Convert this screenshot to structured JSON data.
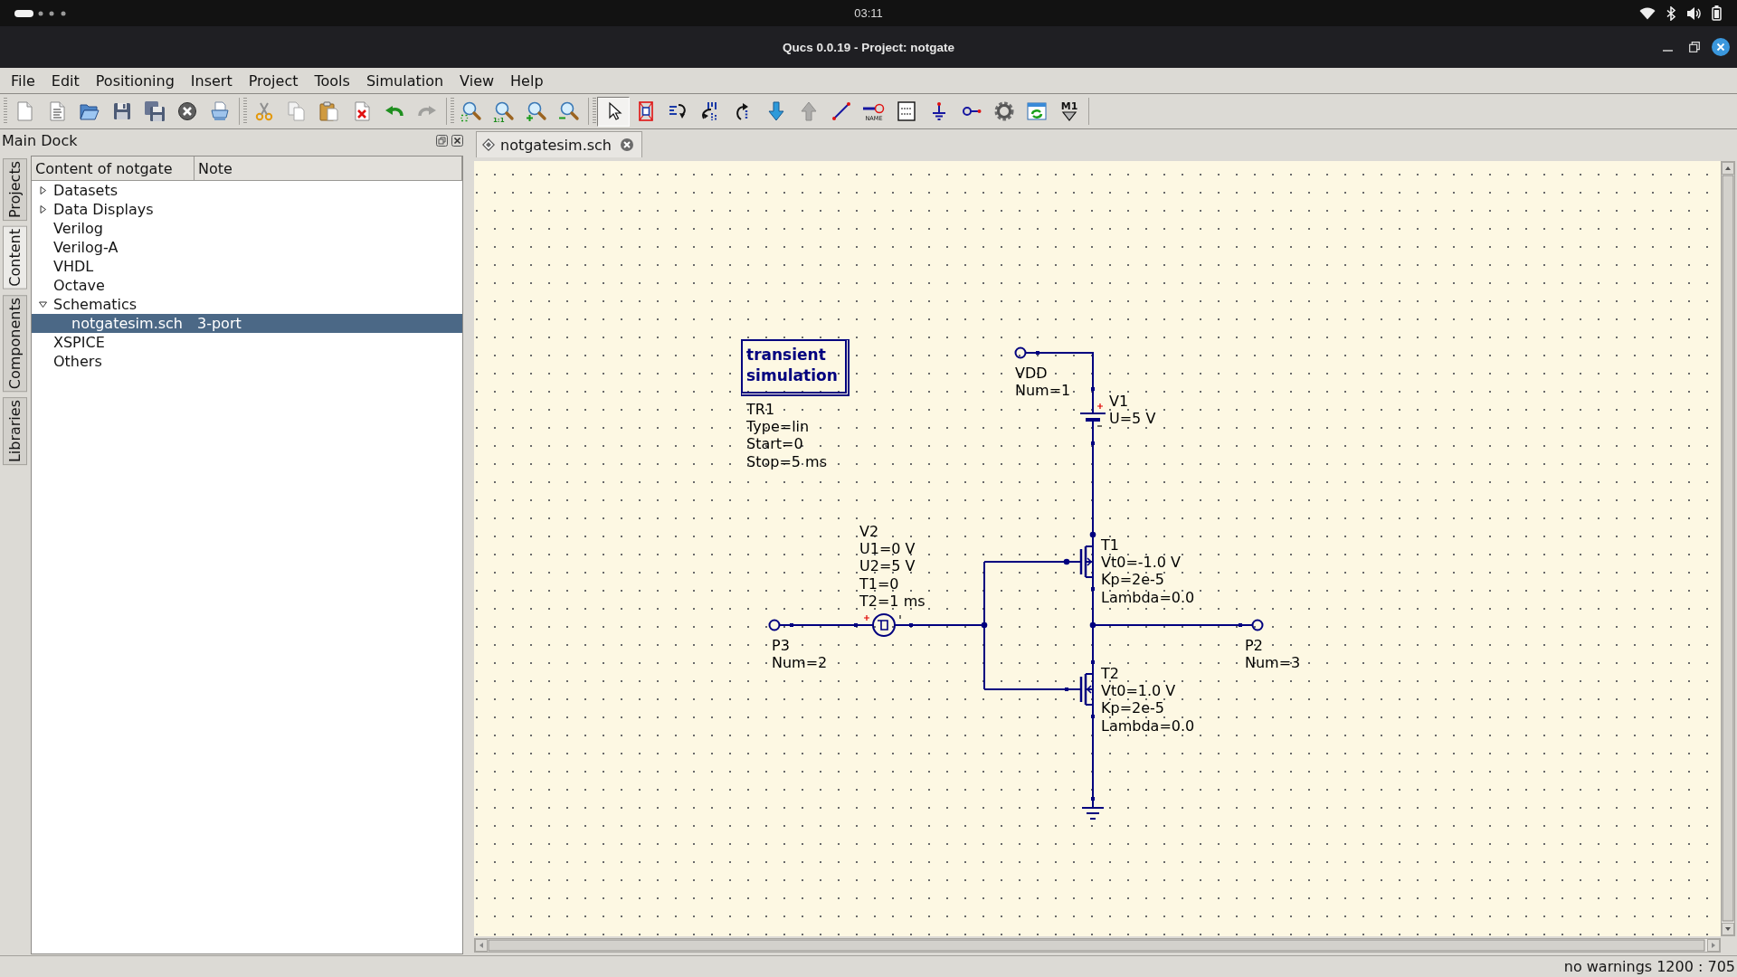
{
  "system_bar": {
    "clock": "03:11"
  },
  "window": {
    "title": "Qucs 0.0.19 - Project: notgate"
  },
  "menu_bar": [
    "File",
    "Edit",
    "Positioning",
    "Insert",
    "Project",
    "Tools",
    "Simulation",
    "View",
    "Help"
  ],
  "toolbar": {
    "groups": [
      {
        "tools": [
          {
            "kind": "page",
            "selected": false,
            "disabled": false
          },
          {
            "kind": "textpage",
            "selected": false,
            "disabled": false
          },
          {
            "kind": "folder",
            "selected": false,
            "disabled": false
          },
          {
            "kind": "floppy",
            "selected": false,
            "disabled": false
          },
          {
            "kind": "floppies",
            "selected": false,
            "disabled": false
          },
          {
            "kind": "closefile",
            "selected": false,
            "disabled": false
          },
          {
            "kind": "printer",
            "selected": false,
            "disabled": false
          }
        ]
      },
      {
        "tools": [
          {
            "kind": "scissors",
            "selected": false,
            "disabled": false
          },
          {
            "kind": "copy",
            "selected": false,
            "disabled": false
          },
          {
            "kind": "paste",
            "selected": false,
            "disabled": false
          },
          {
            "kind": "delete",
            "selected": false,
            "disabled": false
          },
          {
            "kind": "undo",
            "selected": false,
            "disabled": false
          },
          {
            "kind": "redo",
            "selected": false,
            "disabled": true
          }
        ]
      },
      {
        "tools": [
          {
            "kind": "zoomfit",
            "selected": false,
            "disabled": false
          },
          {
            "kind": "zoomone",
            "label": "1:1",
            "selected": false,
            "disabled": false
          },
          {
            "kind": "zoomin",
            "selected": false,
            "disabled": false
          },
          {
            "kind": "zoomout",
            "selected": false,
            "disabled": false
          }
        ]
      },
      {
        "tools": [
          {
            "kind": "pointer",
            "selected": true,
            "disabled": false
          },
          {
            "kind": "deactivate",
            "selected": false,
            "disabled": false
          },
          {
            "kind": "mirrorx",
            "selected": false,
            "disabled": false
          },
          {
            "kind": "mirrory",
            "selected": false,
            "disabled": false
          },
          {
            "kind": "rotate",
            "selected": false,
            "disabled": false
          },
          {
            "kind": "down",
            "selected": false,
            "disabled": false
          },
          {
            "kind": "up",
            "selected": false,
            "disabled": true
          },
          {
            "kind": "wire",
            "selected": false,
            "disabled": false
          },
          {
            "kind": "label",
            "label": "NAME",
            "selected": false,
            "disabled": false
          },
          {
            "kind": "equation",
            "selected": false,
            "disabled": false
          },
          {
            "kind": "ground",
            "selected": false,
            "disabled": false
          },
          {
            "kind": "port",
            "selected": false,
            "disabled": false
          },
          {
            "kind": "simulate",
            "selected": false,
            "disabled": false
          },
          {
            "kind": "display",
            "selected": false,
            "disabled": false
          },
          {
            "kind": "marker",
            "label": "M1",
            "selected": false,
            "disabled": false
          }
        ]
      }
    ]
  },
  "dock": {
    "title": "Main Dock",
    "side_tabs": [
      {
        "label": "Projects",
        "selected": false
      },
      {
        "label": "Content",
        "selected": true
      },
      {
        "label": "Components",
        "selected": false
      },
      {
        "label": "Libraries",
        "selected": false
      }
    ],
    "tree": {
      "columns": [
        "Content of notgate",
        "Note"
      ],
      "items": [
        {
          "label": "Datasets",
          "expanded": false,
          "selected": false
        },
        {
          "label": "Data Displays",
          "expanded": false,
          "selected": false
        },
        {
          "label": "Verilog",
          "selected": false
        },
        {
          "label": "Verilog-A",
          "selected": false
        },
        {
          "label": "VHDL",
          "selected": false
        },
        {
          "label": "Octave",
          "selected": false
        },
        {
          "label": "Schematics",
          "expanded": true,
          "selected": false,
          "children": [
            {
              "label": "notgatesim.sch",
              "note": "3-port",
              "selected": true
            }
          ]
        },
        {
          "label": "XSPICE",
          "selected": false
        },
        {
          "label": "Others",
          "selected": false
        }
      ]
    }
  },
  "document_tabs": [
    {
      "label": "notgatesim.sch",
      "selected": true
    }
  ],
  "schematic": {
    "components": [
      {
        "kind": "simulation",
        "title": "transient simulation",
        "properties": [
          "TR1",
          "Type=lin",
          "Start=0",
          "Stop=5 ms"
        ]
      },
      {
        "kind": "port",
        "properties": [
          "VDD",
          "Num=1"
        ]
      },
      {
        "kind": "dc_source",
        "properties": [
          "V1",
          "U=5 V"
        ]
      },
      {
        "kind": "pulse_source",
        "properties": [
          "V2",
          "U1=0 V",
          "U2=5 V",
          "T1=0",
          "T2=1 ms"
        ]
      },
      {
        "kind": "pmos",
        "properties": [
          "T1",
          "Vt0=-1.0 V",
          "Kp=2e-5",
          "Lambda=0.0"
        ]
      },
      {
        "kind": "port",
        "properties": [
          "P3",
          "Num=2"
        ]
      },
      {
        "kind": "port",
        "properties": [
          "P2",
          "Num=3"
        ]
      },
      {
        "kind": "nmos",
        "properties": [
          "T2",
          "Vt0=1.0 V",
          "Kp=2e-5",
          "Lambda=0.0"
        ]
      },
      {
        "kind": "ground"
      }
    ]
  },
  "status_bar": {
    "message": "no warnings",
    "cursor_position": "1200 : 705"
  }
}
